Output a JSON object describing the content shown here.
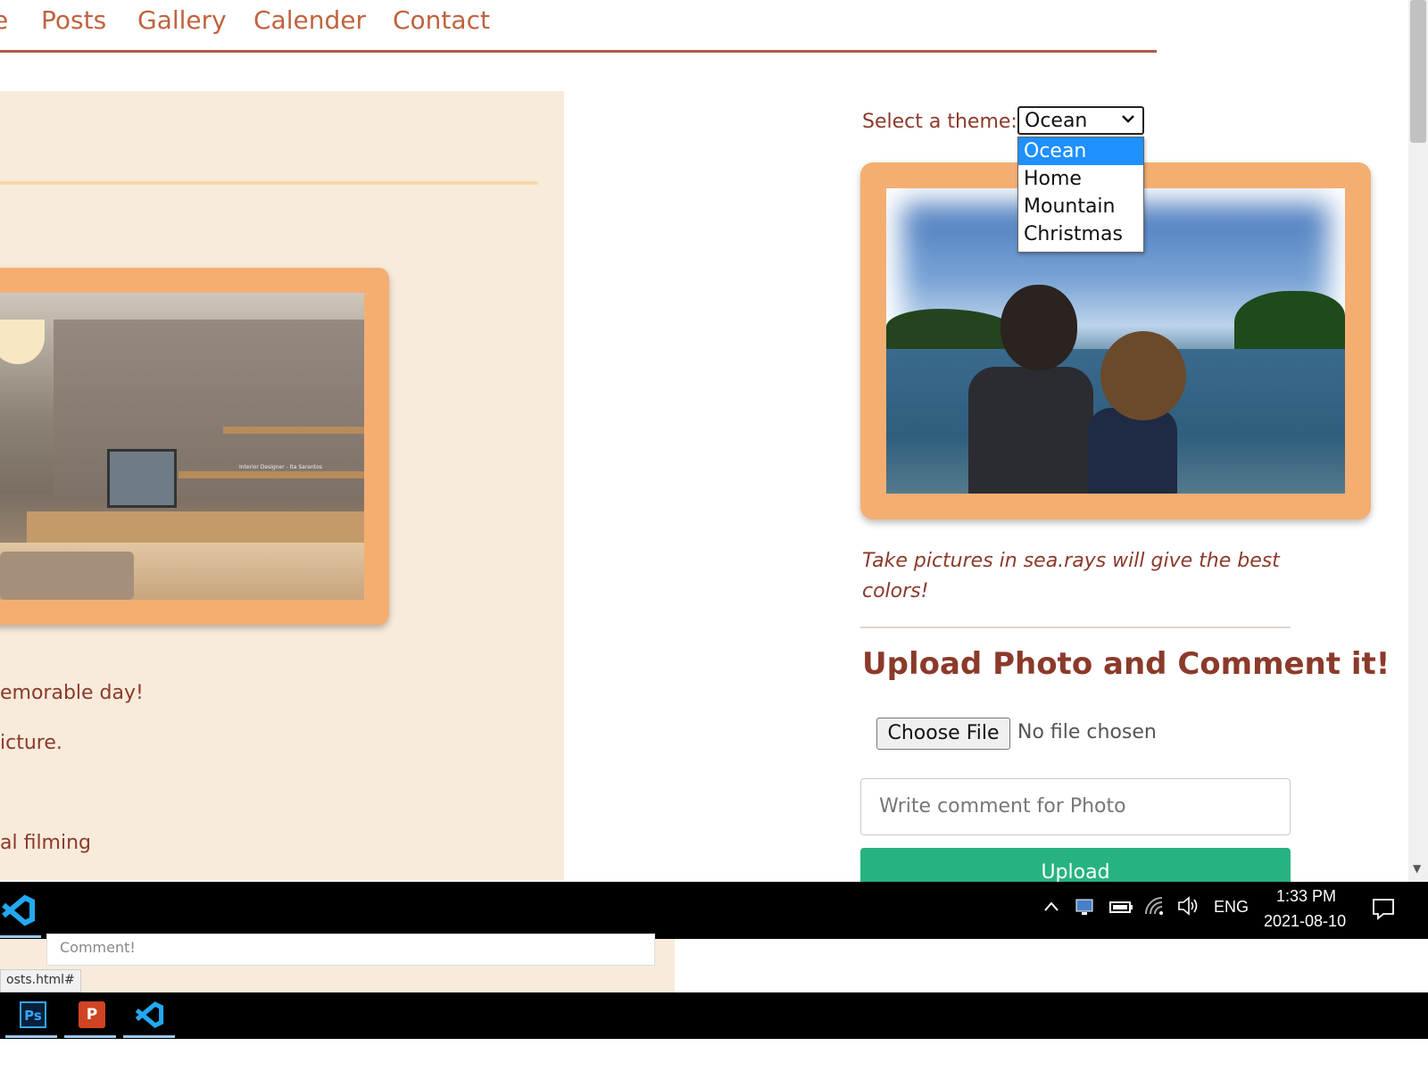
{
  "nav": {
    "items": [
      "e",
      "Posts",
      "Gallery",
      "Calender",
      "Contact"
    ]
  },
  "left": {
    "lines": [
      "emorable day!",
      "icture.",
      "al filming"
    ],
    "photo_overlay_text": "Interior Designer - Ita Sarantos"
  },
  "theme": {
    "label": "Select a theme:",
    "selected": "Ocean",
    "options": [
      "Ocean",
      "Home",
      "Mountain",
      "Christmas"
    ]
  },
  "right": {
    "caption": "Take pictures in sea.rays will give the best colors!",
    "upload_title": "Upload Photo and Comment it!",
    "choose_file": "Choose File",
    "no_file": "No file chosen",
    "comment_placeholder": "Write comment for Photo",
    "upload_button": "Upload"
  },
  "taskbar": {
    "language": "ENG",
    "time": "1:33 PM",
    "date": "2021-08-10"
  },
  "below": {
    "comment_placeholder": "Comment!",
    "status_url": "osts.html#"
  },
  "colors": {
    "accent": "#c0633f",
    "frame": "#f5ae72",
    "panel": "#f8ebdb",
    "upload_button": "#27b380",
    "selected_option": "#1e90ff"
  },
  "icons": [
    "chevron-down-icon",
    "chevron-up-icon",
    "network-icon",
    "battery-icon",
    "wifi-icon",
    "volume-icon",
    "notification-icon",
    "vscode-icon",
    "photoshop-icon",
    "powerpoint-icon"
  ]
}
